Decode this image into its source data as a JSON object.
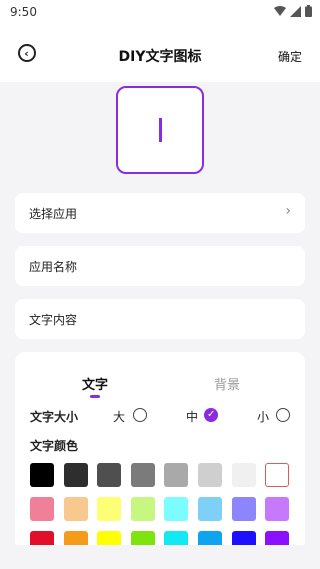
{
  "status": {
    "time": "9:50"
  },
  "header": {
    "title": "DIY文字图标",
    "confirm_label": "确定"
  },
  "form": {
    "select_app_label": "选择应用",
    "app_name_placeholder": "应用名称",
    "text_content_placeholder": "文字内容"
  },
  "tabs": [
    {
      "label": "文字",
      "active": true
    },
    {
      "label": "背景",
      "active": false
    }
  ],
  "text_size": {
    "label": "文字大小",
    "options": [
      {
        "label": "大",
        "checked": false
      },
      {
        "label": "中",
        "checked": true
      },
      {
        "label": "小",
        "checked": false
      }
    ]
  },
  "text_color": {
    "label": "文字颜色",
    "rows": [
      [
        "#000000",
        "#2e2e2e",
        "#4f4f4f",
        "#7b7b7b",
        "#a9a9a9",
        "#cfcfcf",
        "#f0f0f0",
        "#ffffff"
      ],
      [
        "#f08098",
        "#f8c98f",
        "#ffff75",
        "#c8f781",
        "#7bfdfd",
        "#7fd0f7",
        "#8c85fc",
        "#c779fb"
      ],
      [
        "#e0102a",
        "#f59b1c",
        "#ffff00",
        "#7fe40e",
        "#14e8f2",
        "#10a4f0",
        "#1d10ff",
        "#8a10ff"
      ]
    ],
    "selected_index": [
      0,
      7
    ]
  },
  "accent_color": "#8a2be2"
}
